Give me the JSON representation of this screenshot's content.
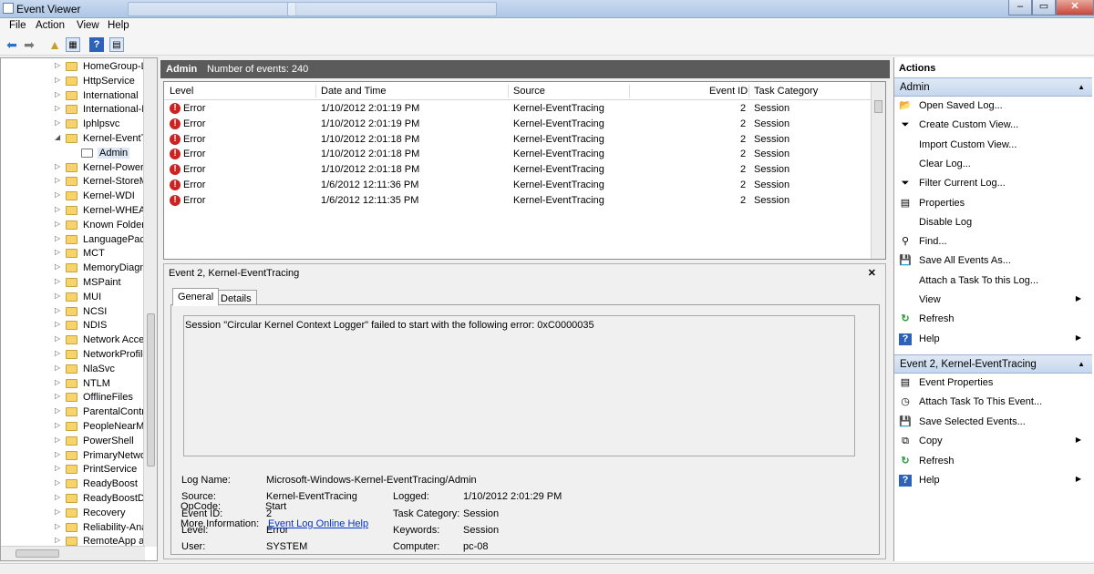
{
  "window": {
    "title": "Event Viewer"
  },
  "menubar": {
    "file": "File",
    "action": "Action",
    "view": "View",
    "help": "Help"
  },
  "tree": {
    "items": [
      {
        "label": "HomeGroup-L"
      },
      {
        "label": "HttpService"
      },
      {
        "label": "International"
      },
      {
        "label": "International-F"
      },
      {
        "label": "Iphlpsvc"
      },
      {
        "label": "Kernel-EventTr"
      },
      {
        "label": "Admin"
      },
      {
        "label": "Kernel-Power"
      },
      {
        "label": "Kernel-StoreM"
      },
      {
        "label": "Kernel-WDI"
      },
      {
        "label": "Kernel-WHEA"
      },
      {
        "label": "Known Folders"
      },
      {
        "label": "LanguagePack"
      },
      {
        "label": "MCT"
      },
      {
        "label": "MemoryDiagn"
      },
      {
        "label": "MSPaint"
      },
      {
        "label": "MUI"
      },
      {
        "label": "NCSI"
      },
      {
        "label": "NDIS"
      },
      {
        "label": "Network Acces"
      },
      {
        "label": "NetworkProfile"
      },
      {
        "label": "NlaSvc"
      },
      {
        "label": "NTLM"
      },
      {
        "label": "OfflineFiles"
      },
      {
        "label": "ParentalContro"
      },
      {
        "label": "PeopleNearMe"
      },
      {
        "label": "PowerShell"
      },
      {
        "label": "PrimaryNetwo"
      },
      {
        "label": "PrintService"
      },
      {
        "label": "ReadyBoost"
      },
      {
        "label": "ReadyBoostDri"
      },
      {
        "label": "Recovery"
      },
      {
        "label": "Reliability-Ana"
      },
      {
        "label": "RemoteApp ar"
      }
    ]
  },
  "center": {
    "log_name": "Admin",
    "event_count_label": "Number of events: 240",
    "columns": {
      "level": "Level",
      "date": "Date and Time",
      "source": "Source",
      "event_id": "Event ID",
      "category": "Task Category"
    },
    "rows": [
      {
        "level": "Error",
        "date": "1/10/2012 2:01:19 PM",
        "source": "Kernel-EventTracing",
        "event_id": "2",
        "category": "Session"
      },
      {
        "level": "Error",
        "date": "1/10/2012 2:01:19 PM",
        "source": "Kernel-EventTracing",
        "event_id": "2",
        "category": "Session"
      },
      {
        "level": "Error",
        "date": "1/10/2012 2:01:18 PM",
        "source": "Kernel-EventTracing",
        "event_id": "2",
        "category": "Session"
      },
      {
        "level": "Error",
        "date": "1/10/2012 2:01:18 PM",
        "source": "Kernel-EventTracing",
        "event_id": "2",
        "category": "Session"
      },
      {
        "level": "Error",
        "date": "1/10/2012 2:01:18 PM",
        "source": "Kernel-EventTracing",
        "event_id": "2",
        "category": "Session"
      },
      {
        "level": "Error",
        "date": "1/6/2012 12:11:36 PM",
        "source": "Kernel-EventTracing",
        "event_id": "2",
        "category": "Session"
      },
      {
        "level": "Error",
        "date": "1/6/2012 12:11:35 PM",
        "source": "Kernel-EventTracing",
        "event_id": "2",
        "category": "Session"
      }
    ],
    "detail": {
      "title": "Event 2, Kernel-EventTracing",
      "close": "✕",
      "tab_general": "General",
      "tab_details": "Details",
      "message": "Session \"Circular Kernel Context Logger\" failed to start with the following error: 0xC0000035",
      "labels": {
        "log_name": "Log Name:",
        "source": "Source:",
        "event_id": "Event ID:",
        "level": "Level:",
        "user": "User:",
        "opcode": "OpCode:",
        "more_info": "More Information:",
        "logged": "Logged:",
        "task_category": "Task Category:",
        "keywords": "Keywords:",
        "computer": "Computer:"
      },
      "values": {
        "log_name": "Microsoft-Windows-Kernel-EventTracing/Admin",
        "source": "Kernel-EventTracing",
        "event_id": "2",
        "level": "Error",
        "user": "SYSTEM",
        "opcode": "Start",
        "more_info_link": "Event Log Online Help",
        "logged": "1/10/2012 2:01:29 PM",
        "task_category": "Session",
        "keywords": "Session",
        "computer": "pc-08"
      }
    }
  },
  "actions": {
    "header": "Actions",
    "section1": "Admin",
    "section1_items": [
      {
        "label": "Open Saved Log...",
        "icon": "open-folder-icon"
      },
      {
        "label": "Create Custom View...",
        "icon": "filter-icon"
      },
      {
        "label": "Import Custom View...",
        "icon": ""
      },
      {
        "label": "Clear Log...",
        "icon": ""
      },
      {
        "label": "Filter Current Log...",
        "icon": "filter-icon"
      },
      {
        "label": "Properties",
        "icon": "properties-icon"
      },
      {
        "label": "Disable Log",
        "icon": ""
      },
      {
        "label": "Find...",
        "icon": "find-icon"
      },
      {
        "label": "Save All Events As...",
        "icon": "save-icon"
      },
      {
        "label": "Attach a Task To this Log...",
        "icon": ""
      },
      {
        "label": "View",
        "icon": ""
      },
      {
        "label": "Refresh",
        "icon": "refresh-icon"
      },
      {
        "label": "Help",
        "icon": "help-icon"
      }
    ],
    "section2": "Event 2, Kernel-EventTracing",
    "section2_items": [
      {
        "label": "Event Properties",
        "icon": "properties-icon"
      },
      {
        "label": "Attach Task To This Event...",
        "icon": "task-icon"
      },
      {
        "label": "Save Selected Events...",
        "icon": "save-icon"
      },
      {
        "label": "Copy",
        "icon": "copy-icon"
      },
      {
        "label": "Refresh",
        "icon": "refresh-icon"
      },
      {
        "label": "Help",
        "icon": "help-icon"
      }
    ]
  },
  "colors": {
    "accent": "#c6d8ee",
    "error": "#cc2222",
    "link": "#0033cc",
    "header_dark": "#5b5b5b"
  }
}
